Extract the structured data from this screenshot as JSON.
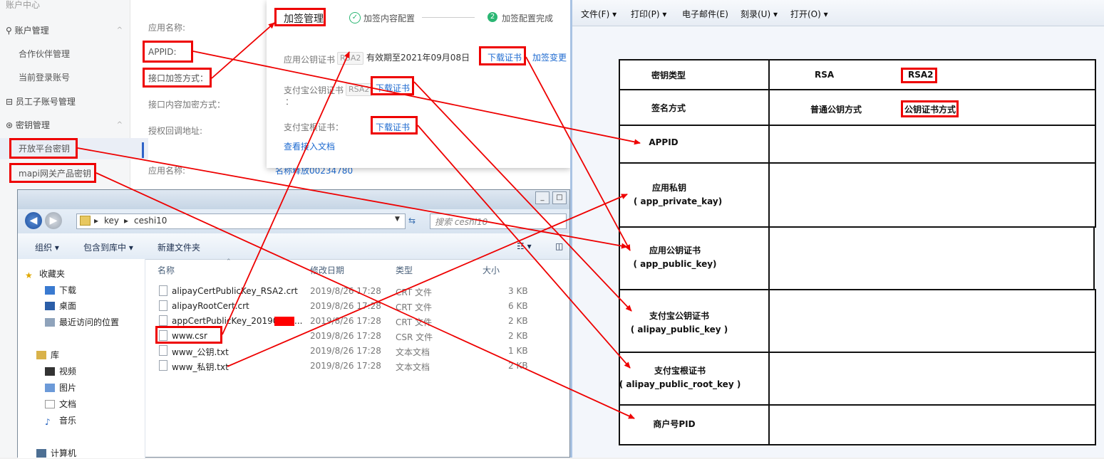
{
  "portal": {
    "account_center": "账户中心",
    "sidebar": [
      {
        "label": "账户管理",
        "type": "group",
        "chev": "^"
      },
      {
        "label": "合作伙伴管理",
        "type": "sub"
      },
      {
        "label": "当前登录账号",
        "type": "sub"
      },
      {
        "label": "员工子账号管理",
        "type": "group"
      },
      {
        "label": "密钥管理",
        "type": "group",
        "chev": "^"
      },
      {
        "label": "开放平台密钥",
        "type": "sub"
      },
      {
        "label": "mapi网关产品密钥",
        "type": "sub"
      }
    ],
    "form": {
      "app_name_label": "应用名称:",
      "appid_label": "APPID:",
      "sign_method_label": "接口加签方式：",
      "content_encrypt_label": "接口内容加密方式：",
      "callback_label": "授权回调地址:",
      "app_name_label2": "应用名称:",
      "app_name_value2": "名称释放00234780"
    }
  },
  "dialog": {
    "title": "加签管理",
    "steps": [
      {
        "icon": "✓",
        "label": "加签内容配置"
      },
      {
        "icon": "2",
        "label": "加签配置完成"
      }
    ],
    "rows": [
      {
        "label": "应用公钥证书",
        "tag": "RSA2",
        "expiry": "有效期至2021年09月08日",
        "link": "下载证书",
        "link2": "加签变更"
      },
      {
        "label": "支付宝公钥证书",
        "tag": "RSA2",
        "link": "下载证书",
        "colon": "："
      },
      {
        "label": "支付宝根证书：",
        "link": "下载证书"
      }
    ],
    "doc_link": "查看接入文档"
  },
  "explorer": {
    "path": [
      "key",
      "ceshi10"
    ],
    "search_placeholder": "搜索 ceshi10",
    "toolbar": [
      "组织 ▾",
      "包含到库中 ▾",
      "新建文件夹"
    ],
    "nav": {
      "favorites": "收藏夹",
      "downloads": "下载",
      "desktop": "桌面",
      "recent": "最近访问的位置",
      "libraries": "库",
      "videos": "视频",
      "pictures": "图片",
      "documents": "文档",
      "music": "音乐",
      "computer": "计算机"
    },
    "columns": [
      "名称",
      "修改日期",
      "类型",
      "大小"
    ],
    "files": [
      {
        "name": "alipayCertPublicKey_RSA2.crt",
        "date": "2019/8/26 17:28",
        "type": "CRT 文件",
        "size": "3 KB"
      },
      {
        "name": "alipayRootCert.crt",
        "date": "2019/8/26 17:28",
        "type": "CRT 文件",
        "size": "6 KB"
      },
      {
        "name": "appCertPublicKey_20190",
        "date": "2019/8/26 17:28",
        "type": "CRT 文件",
        "size": "2 KB",
        "suffix": "..."
      },
      {
        "name": "www.csr",
        "date": "2019/8/26 17:28",
        "type": "CSR 文件",
        "size": "2 KB"
      },
      {
        "name": "www_公钥.txt",
        "date": "2019/8/26 17:28",
        "type": "文本文档",
        "size": "1 KB"
      },
      {
        "name": "www_私钥.txt",
        "date": "2019/8/26 17:28",
        "type": "文本文档",
        "size": "2 KB"
      }
    ]
  },
  "doc": {
    "menu": [
      "文件(F) ▾",
      "打印(P) ▾",
      "电子邮件(E)",
      "刻录(U) ▾",
      "打开(O) ▾"
    ],
    "table": {
      "key_type_label": "密钥类型",
      "key_type_value": "RSA",
      "key_type_highlight": "RSA2",
      "sign_label": "签名方式",
      "sign_value": "普通公钥方式",
      "sign_highlight": "公钥证书方式",
      "appid": "APPID",
      "app_private_key": "应用私钥",
      "app_private_key_en": "( app_private_kay)",
      "app_public_key": "应用公钥证书",
      "app_public_key_en": "( app_public_key)",
      "alipay_public_key": "支付宝公钥证书",
      "alipay_public_key_en": "( alipay_public_key )",
      "alipay_root_key": "支付宝根证书",
      "alipay_root_key_en": "( alipay_public_root_key )",
      "pid": "商户号PID"
    }
  },
  "colors": {
    "highlight": "#e00000",
    "link": "#1f6bd0",
    "green": "#2bb673"
  }
}
